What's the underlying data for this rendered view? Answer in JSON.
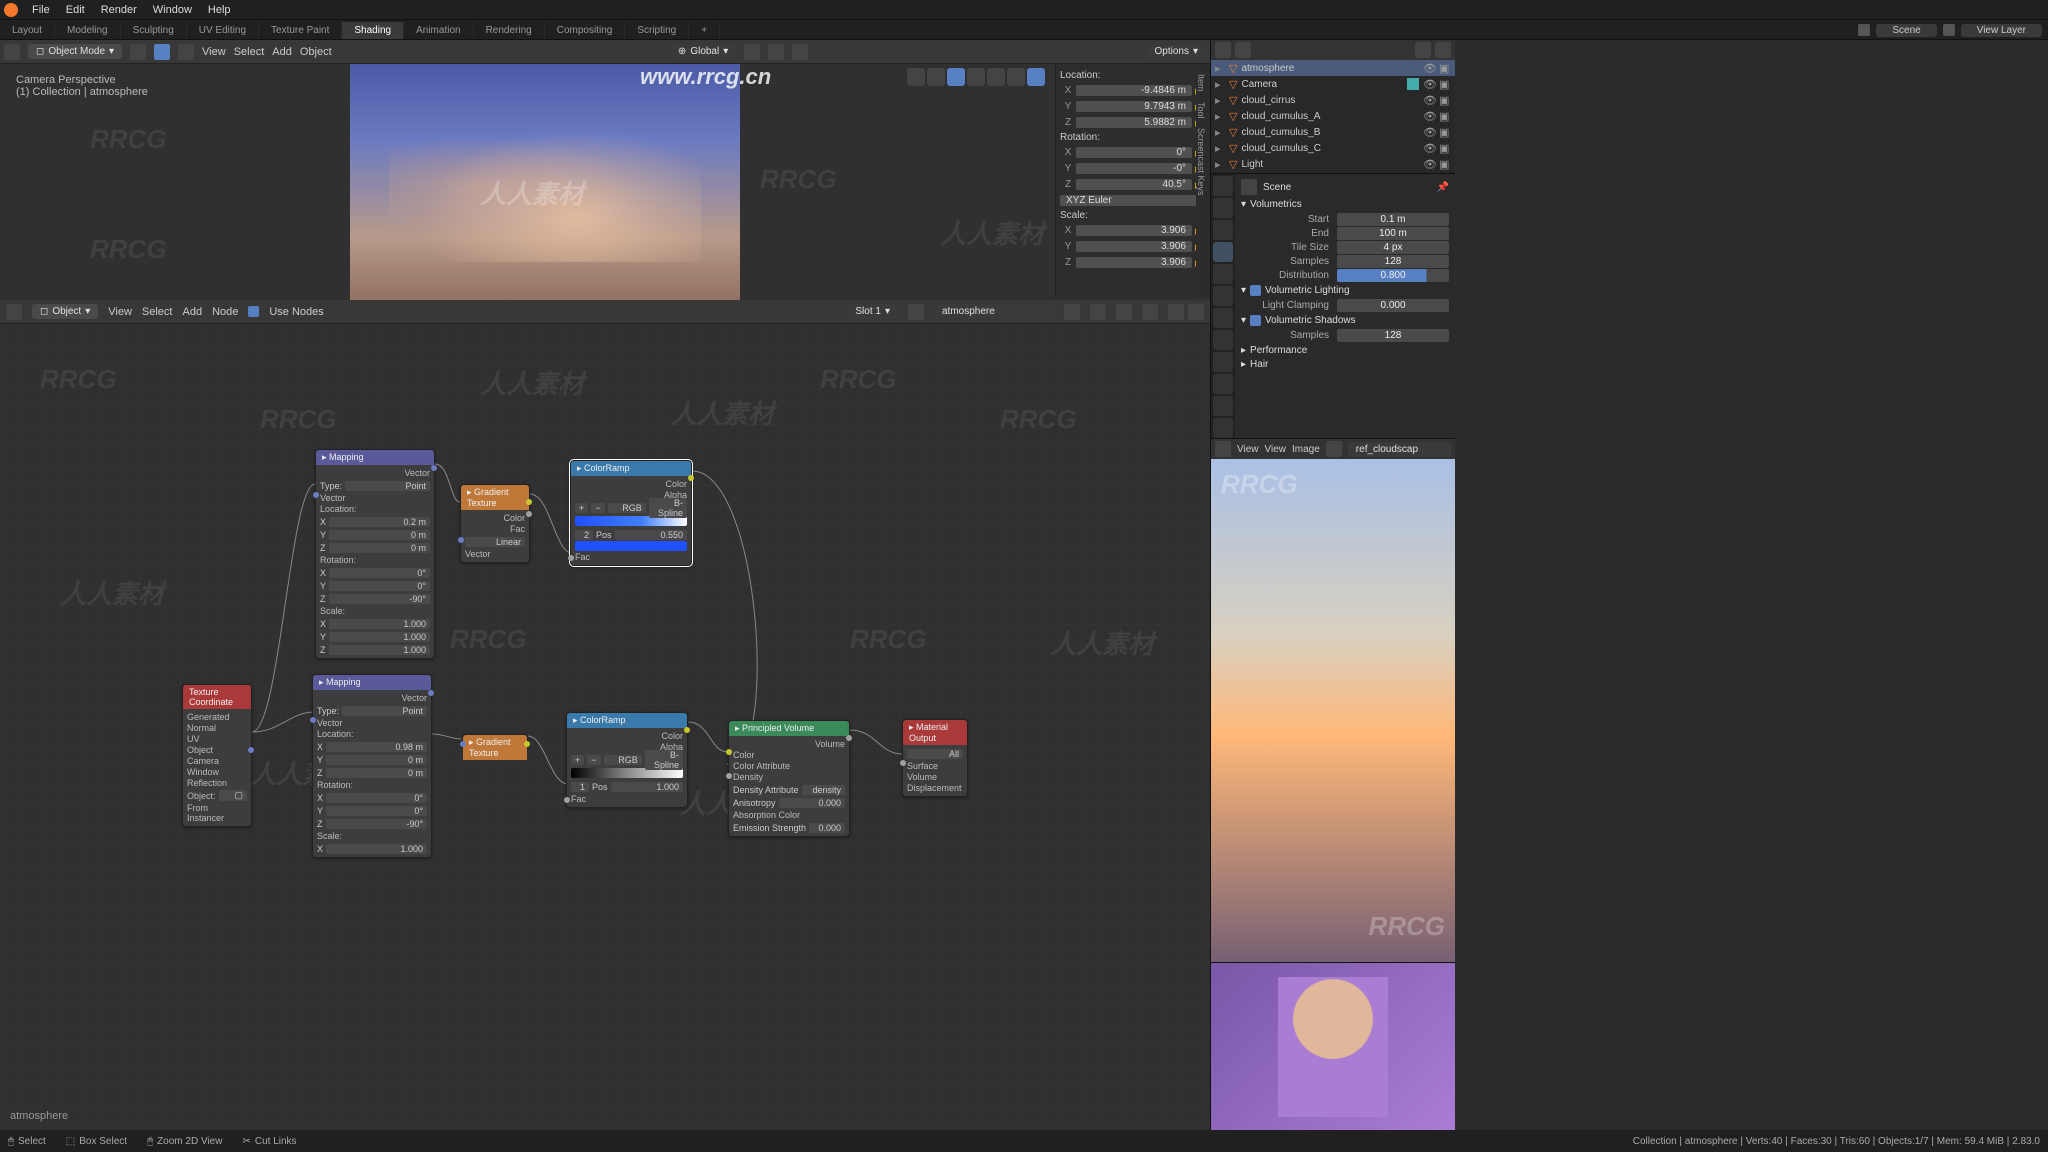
{
  "app": {
    "menus": [
      "File",
      "Edit",
      "Render",
      "Window",
      "Help"
    ]
  },
  "workspace_tabs": [
    "Layout",
    "Modeling",
    "Sculpting",
    "UV Editing",
    "Texture Paint",
    "Shading",
    "Animation",
    "Rendering",
    "Compositing",
    "Scripting"
  ],
  "workspace_active": "Shading",
  "top_right": {
    "scene": "Scene",
    "view_layer": "View Layer"
  },
  "watermark": {
    "logo": "RRCG",
    "url": "www.rrcg.cn",
    "chinese": "人人素材"
  },
  "viewport": {
    "mode": "Object Mode",
    "menus": [
      "View",
      "Select",
      "Add",
      "Object"
    ],
    "orient": "Global",
    "options": "Options",
    "info1": "Camera Perspective",
    "info2": "(1) Collection | atmosphere",
    "transform": {
      "location_lbl": "Location:",
      "loc": [
        {
          "ax": "X",
          "v": "-9.4846 m"
        },
        {
          "ax": "Y",
          "v": "9.7943 m"
        },
        {
          "ax": "Z",
          "v": "5.9882 m"
        }
      ],
      "rotation_lbl": "Rotation:",
      "rot": [
        {
          "ax": "X",
          "v": "0°"
        },
        {
          "ax": "Y",
          "v": "-0°"
        },
        {
          "ax": "Z",
          "v": "40.5°"
        }
      ],
      "mode": "XYZ Euler",
      "scale_lbl": "Scale:",
      "scale": [
        {
          "ax": "X",
          "v": "3.906"
        },
        {
          "ax": "Y",
          "v": "3.906"
        },
        {
          "ax": "Z",
          "v": "3.906"
        }
      ]
    },
    "vtabs": [
      "Item",
      "Tool",
      "Screencast Keys"
    ]
  },
  "node_editor": {
    "mode": "Object",
    "menus": [
      "View",
      "Select",
      "Add",
      "Node"
    ],
    "use_nodes": "Use Nodes",
    "slot": "Slot 1",
    "material": "atmosphere",
    "breadcrumb": "atmosphere"
  },
  "nodes": {
    "texcoord": {
      "title": "Texture Coordinate",
      "outs": [
        "Generated",
        "Normal",
        "UV",
        "Object",
        "Camera",
        "Window",
        "Reflection"
      ],
      "object": "Object:",
      "frominst": "From Instancer"
    },
    "mapping1": {
      "title": "Mapping",
      "type_lbl": "Type:",
      "type": "Point",
      "vector": "Vector",
      "loc_lbl": "Location:",
      "loc": [
        {
          "a": "X",
          "v": "0.2 m"
        },
        {
          "a": "Y",
          "v": "0 m"
        },
        {
          "a": "Z",
          "v": "0 m"
        }
      ],
      "rot_lbl": "Rotation:",
      "rot": [
        {
          "a": "X",
          "v": "0°"
        },
        {
          "a": "Y",
          "v": "0°"
        },
        {
          "a": "Z",
          "v": "-90°"
        }
      ],
      "scl_lbl": "Scale:",
      "scl": [
        {
          "a": "X",
          "v": "1.000"
        },
        {
          "a": "Y",
          "v": "1.000"
        },
        {
          "a": "Z",
          "v": "1.000"
        }
      ]
    },
    "mapping2": {
      "title": "Mapping",
      "type_lbl": "Type:",
      "type": "Point",
      "vector": "Vector",
      "loc_lbl": "Location:",
      "loc": [
        {
          "a": "X",
          "v": "0.98 m"
        },
        {
          "a": "Y",
          "v": "0 m"
        },
        {
          "a": "Z",
          "v": "0 m"
        }
      ],
      "rot_lbl": "Rotation:",
      "rot": [
        {
          "a": "X",
          "v": "0°"
        },
        {
          "a": "Y",
          "v": "0°"
        },
        {
          "a": "Z",
          "v": "-90°"
        }
      ],
      "scl_lbl": "Scale:",
      "scl": [
        {
          "a": "X",
          "v": "1.000"
        }
      ]
    },
    "grad1": {
      "title": "Gradient Texture",
      "color": "Color",
      "fac": "Fac",
      "mode": "Linear",
      "vector": "Vector"
    },
    "grad2": {
      "title": "Gradient Texture"
    },
    "ramp1": {
      "title": "ColorRamp",
      "color": "Color",
      "alpha": "Alpha",
      "rgb": "RGB",
      "interp": "B-Spline",
      "pos": "Pos",
      "pos_v": "0.550",
      "idx": "2",
      "fac": "Fac"
    },
    "ramp2": {
      "title": "ColorRamp",
      "color": "Color",
      "alpha": "Alpha",
      "rgb": "RGB",
      "interp": "B-Spline",
      "pos": "Pos",
      "pos_v": "1.000",
      "idx": "1",
      "fac": "Fac"
    },
    "pvol": {
      "title": "Principled Volume",
      "volume": "Volume",
      "rows": [
        "Color",
        "Color Attribute",
        "Density",
        "Density Attribute",
        "Anisotropy",
        "Absorption Color",
        "Emission Strength"
      ],
      "density_attr": "density",
      "anisotropy": "0.000",
      "emission_strength": "0.000"
    },
    "out": {
      "title": "Material Output",
      "all": "All",
      "surface": "Surface",
      "volume": "Volume",
      "displacement": "Displacement"
    }
  },
  "outliner": {
    "items": [
      {
        "name": "atmosphere",
        "active": true
      },
      {
        "name": "Camera"
      },
      {
        "name": "cloud_cirrus"
      },
      {
        "name": "cloud_cumulus_A"
      },
      {
        "name": "cloud_cumulus_B"
      },
      {
        "name": "cloud_cumulus_C"
      },
      {
        "name": "Light"
      }
    ]
  },
  "properties": {
    "context": "Scene",
    "volumetrics": "Volumetrics",
    "fields": [
      {
        "lbl": "Start",
        "val": "0.1 m"
      },
      {
        "lbl": "End",
        "val": "100 m"
      },
      {
        "lbl": "Tile Size",
        "val": "4 px"
      },
      {
        "lbl": "Samples",
        "val": "128"
      },
      {
        "lbl": "Distribution",
        "val": "0.800",
        "slider": true
      }
    ],
    "vol_lighting": "Volumetric Lighting",
    "light_clamp": {
      "lbl": "Light Clamping",
      "val": "0.000"
    },
    "vol_shadows": "Volumetric Shadows",
    "shadow_samples": {
      "lbl": "Samples",
      "val": "128"
    },
    "performance": "Performance",
    "hair": "Hair"
  },
  "image_editor": {
    "menus": [
      "View",
      "View",
      "Image"
    ],
    "image": "ref_cloudscap",
    "view_lbl": "View"
  },
  "statusbar": {
    "left": [
      {
        "icon": "🖱",
        "text": "Select"
      },
      {
        "icon": "⬚",
        "text": "Box Select"
      },
      {
        "icon": "🖱",
        "text": "Zoom 2D View"
      },
      {
        "icon": "✂",
        "text": "Cut Links"
      }
    ],
    "right": "Collection | atmosphere | Verts:40 | Faces:30 | Tris:60 | Objects:1/7 | Mem: 59.4 MiB | 2.83.0"
  }
}
